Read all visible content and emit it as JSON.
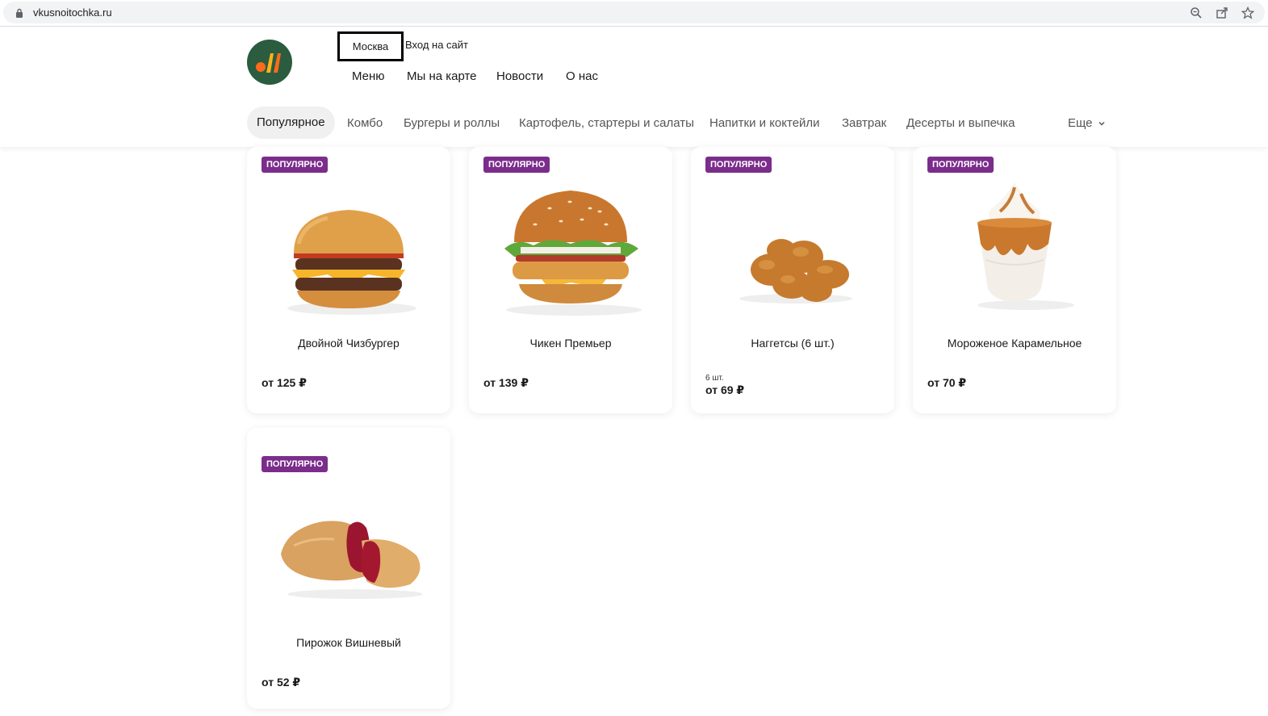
{
  "browser": {
    "url": "vkusnoitochka.ru",
    "icons": [
      "lock-icon",
      "zoom-icon",
      "share-icon",
      "bookmark-star-icon"
    ]
  },
  "header": {
    "city": "Москва",
    "login": "Вход на сайт",
    "nav": [
      "Меню",
      "Мы на карте",
      "Новости",
      "О нас"
    ],
    "colors": {
      "logo_bg": "#2b5c3f",
      "logo_mark": "#ff6b1a"
    }
  },
  "categories": {
    "items": [
      "Популярное",
      "Комбо",
      "Бургеры и роллы",
      "Картофель, стартеры и салаты",
      "Напитки и коктейли",
      "Завтрак",
      "Десерты и выпечка"
    ],
    "active": "Популярное",
    "more": "Еще"
  },
  "products": [
    {
      "badge": "ПОПУЛЯРНО",
      "name": "Двойной Чизбургер",
      "qty": "",
      "price": "от 125 ₽",
      "icon": "burger-icon"
    },
    {
      "badge": "ПОПУЛЯРНО",
      "name": "Чикен Премьер",
      "qty": "",
      "price": "от 139 ₽",
      "icon": "chicken-burger-icon"
    },
    {
      "badge": "ПОПУЛЯРНО",
      "name": "Наггетсы (6 шт.)",
      "qty": "6 шт.",
      "price": "от 69 ₽",
      "icon": "nuggets-icon"
    },
    {
      "badge": "ПОПУЛЯРНО",
      "name": "Мороженое Карамельное",
      "qty": "",
      "price": "от 70 ₽",
      "icon": "ice-cream-icon"
    },
    {
      "badge": "ПОПУЛЯРНО",
      "name": "Пирожок Вишневый",
      "qty": "",
      "price": "от 52 ₽",
      "icon": "cherry-pie-icon"
    }
  ],
  "colors": {
    "badge": "#7b2d8c",
    "active_category_bg": "#f0f0f0"
  }
}
